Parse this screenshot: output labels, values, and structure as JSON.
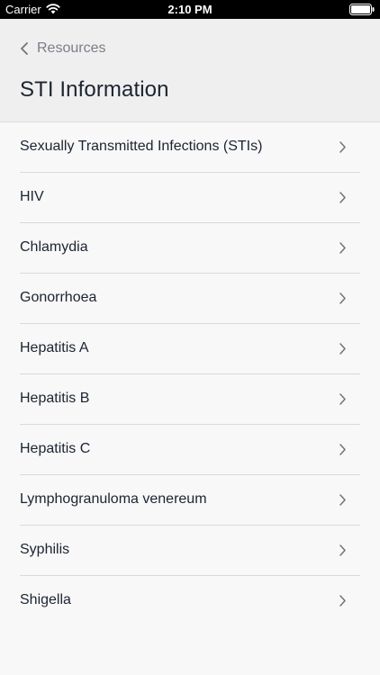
{
  "status_bar": {
    "carrier": "Carrier",
    "time": "2:10 PM"
  },
  "header": {
    "back_label": "Resources",
    "title": "STI Information"
  },
  "list": {
    "items": [
      {
        "label": "Sexually Transmitted Infections (STIs)"
      },
      {
        "label": "HIV"
      },
      {
        "label": "Chlamydia"
      },
      {
        "label": "Gonorrhoea"
      },
      {
        "label": "Hepatitis A"
      },
      {
        "label": "Hepatitis B"
      },
      {
        "label": "Hepatitis C"
      },
      {
        "label": "Lymphogranuloma venereum"
      },
      {
        "label": "Syphilis"
      },
      {
        "label": "Shigella"
      }
    ]
  }
}
